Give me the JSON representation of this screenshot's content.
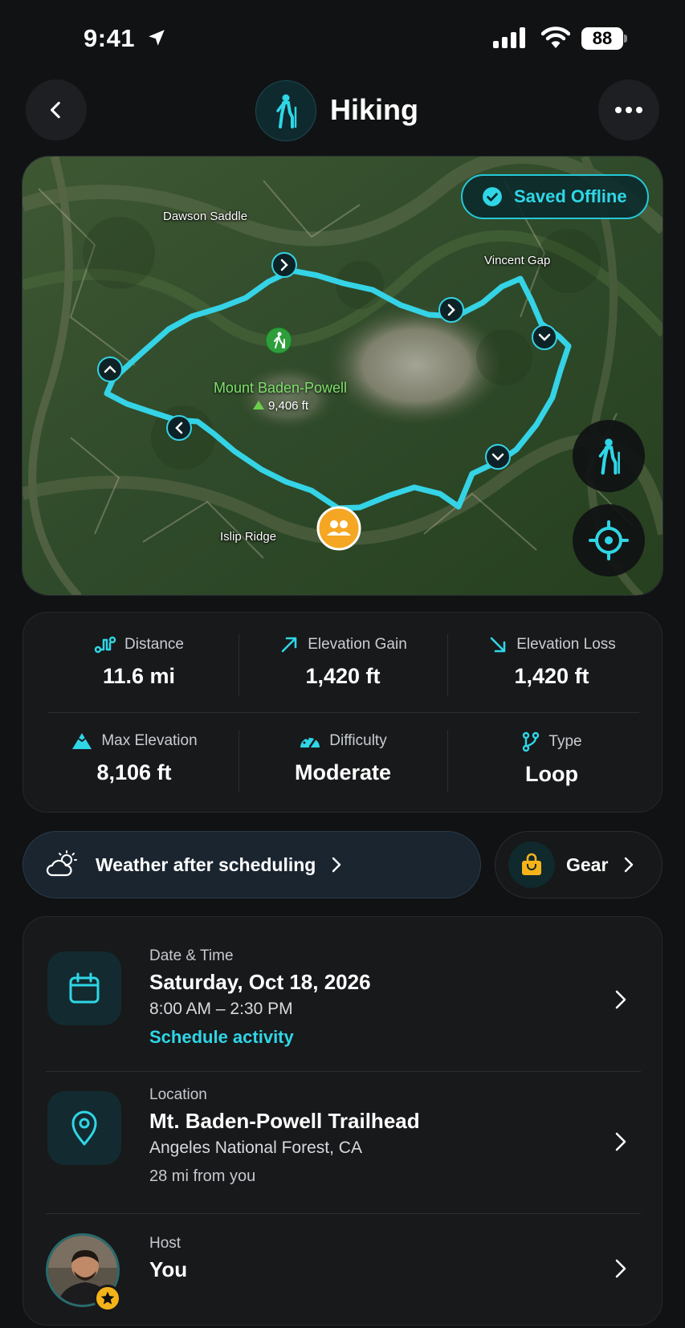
{
  "status_bar": {
    "time": "9:41",
    "battery": "88"
  },
  "header": {
    "title": "Hiking"
  },
  "map": {
    "saved_badge": "Saved Offline",
    "labels": {
      "dawson": "Dawson Saddle",
      "vincent": "Vincent Gap",
      "islip": "Islip Ridge"
    },
    "peak": {
      "name": "Mount Baden-Powell",
      "elevation": "9,406 ft"
    }
  },
  "stats": [
    {
      "label": "Distance",
      "value": "11.6 mi",
      "icon": "route-icon"
    },
    {
      "label": "Elevation Gain",
      "value": "1,420 ft",
      "icon": "arrow-up-right-icon"
    },
    {
      "label": "Elevation Loss",
      "value": "1,420 ft",
      "icon": "arrow-down-right-icon"
    },
    {
      "label": "Max Elevation",
      "value": "8,106 ft",
      "icon": "mountain-icon"
    },
    {
      "label": "Difficulty",
      "value": "Moderate",
      "icon": "gauge-icon"
    },
    {
      "label": "Type",
      "value": "Loop",
      "icon": "branch-icon"
    }
  ],
  "weather": {
    "label": "Weather after scheduling"
  },
  "gear": {
    "label": "Gear"
  },
  "details": {
    "datetime": {
      "label": "Date & Time",
      "date": "Saturday, Oct 18, 2026",
      "time": "8:00 AM – 2:30 PM",
      "link": "Schedule activity"
    },
    "location": {
      "label": "Location",
      "name": "Mt. Baden-Powell Trailhead",
      "area": "Angeles National Forest, CA",
      "distance": "28 mi from you"
    },
    "host": {
      "label": "Host",
      "name": "You"
    }
  },
  "colors": {
    "accent": "#2fd6e6",
    "background": "#111214",
    "card": "#18191b",
    "group_marker": "#f5a623"
  }
}
